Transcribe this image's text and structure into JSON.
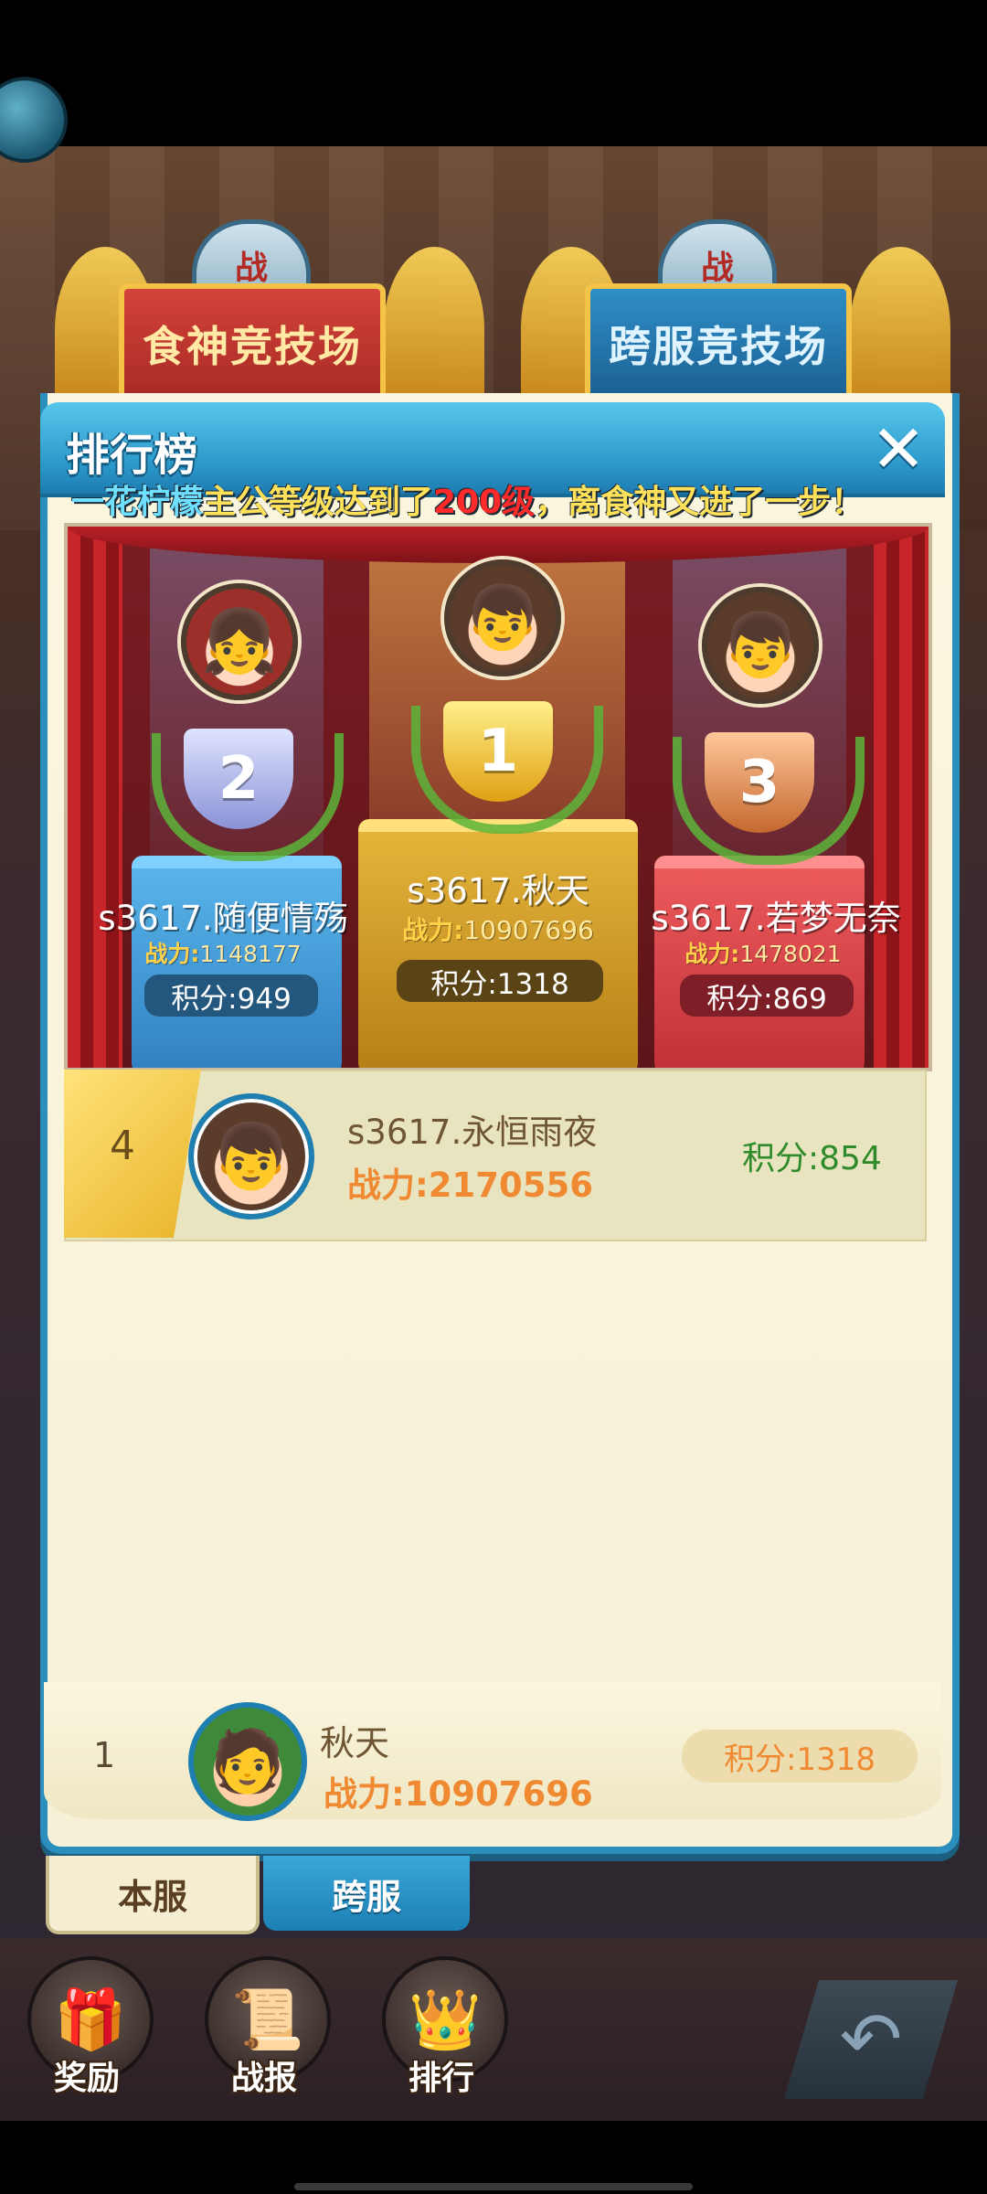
{
  "background": {
    "arena_left_label": "食神竞技场",
    "arena_right_label": "跨服竞技场",
    "arena_emblem_text": "战"
  },
  "panel": {
    "title": "排行榜",
    "close_label": "✕",
    "news": {
      "player": "一花柠檬",
      "middle": "主公等级达到了",
      "level": "200级",
      "tail": "，离食神又进了一步！"
    }
  },
  "podium": [
    {
      "rank": "2",
      "name": "s3617.随便情殇",
      "power_label": "战力:",
      "power": "1148177",
      "score": "积分:949",
      "avatar": "girl-avatar"
    },
    {
      "rank": "1",
      "name": "s3617.秋天",
      "power_label": "战力:",
      "power": "10907696",
      "score": "积分:1318",
      "avatar": "boy-avatar"
    },
    {
      "rank": "3",
      "name": "s3617.若梦无奈",
      "power_label": "战力:",
      "power": "1478021",
      "score": "积分:869",
      "avatar": "boy-avatar"
    }
  ],
  "ranking_rows": [
    {
      "rank": "4",
      "name": "s3617.永恒雨夜",
      "power_label": "战力:",
      "power": "2170556",
      "score": "积分:854"
    }
  ],
  "self": {
    "rank": "1",
    "name": "秋天",
    "power_label": "战力:",
    "power": "10907696",
    "score": "积分:1318"
  },
  "tabs": [
    {
      "label": "本服",
      "active": true
    },
    {
      "label": "跨服",
      "active": false
    }
  ],
  "bottom_nav": [
    {
      "label": "奖励",
      "icon": "treasure-chest-icon"
    },
    {
      "label": "战报",
      "icon": "scroll-icon"
    },
    {
      "label": "排行",
      "icon": "crown-icon"
    }
  ],
  "colors": {
    "panel_header": "#2b97c9",
    "power_text": "#f08a32",
    "score_green": "#2e8a2a",
    "news_highlight": "#ff2a2a"
  }
}
